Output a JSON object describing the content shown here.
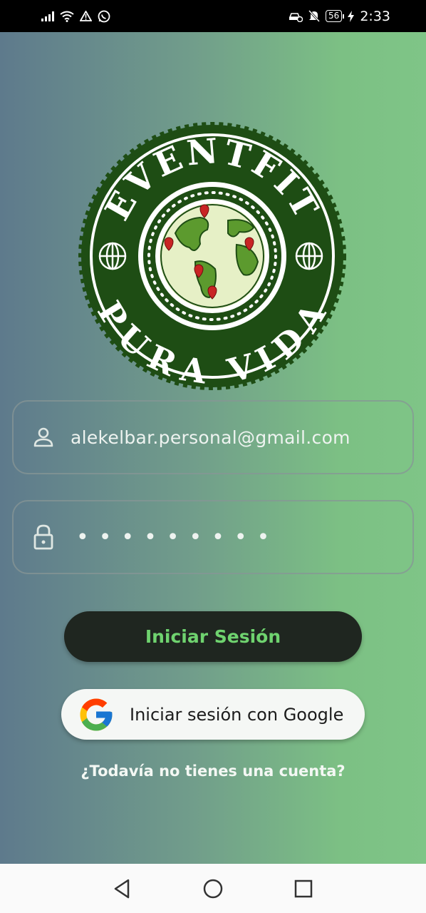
{
  "status_bar": {
    "time": "2:33",
    "battery": "56",
    "left_icons": [
      "signal-icon",
      "wifi-icon",
      "warning-icon",
      "whatsapp-icon"
    ],
    "right_icons": [
      "car-icon",
      "mute-icon",
      "battery-icon",
      "charging-icon"
    ]
  },
  "logo": {
    "top_text": "EVENTFIT",
    "bottom_text": "PURA VIDA"
  },
  "login_form": {
    "email_value": "alekelbar.personal@gmail.com",
    "password_value": "•••••••••",
    "email_icon": "user-icon",
    "password_icon": "lock-icon"
  },
  "buttons": {
    "login_label": "Iniciar Sesión",
    "google_label": "Iniciar sesión con Google"
  },
  "signup_link": "¿Todavía no tienes una cuenta?",
  "colors": {
    "accent_green": "#6fd36f",
    "dark_button": "#1f2620",
    "logo_green": "#1e4d14"
  }
}
